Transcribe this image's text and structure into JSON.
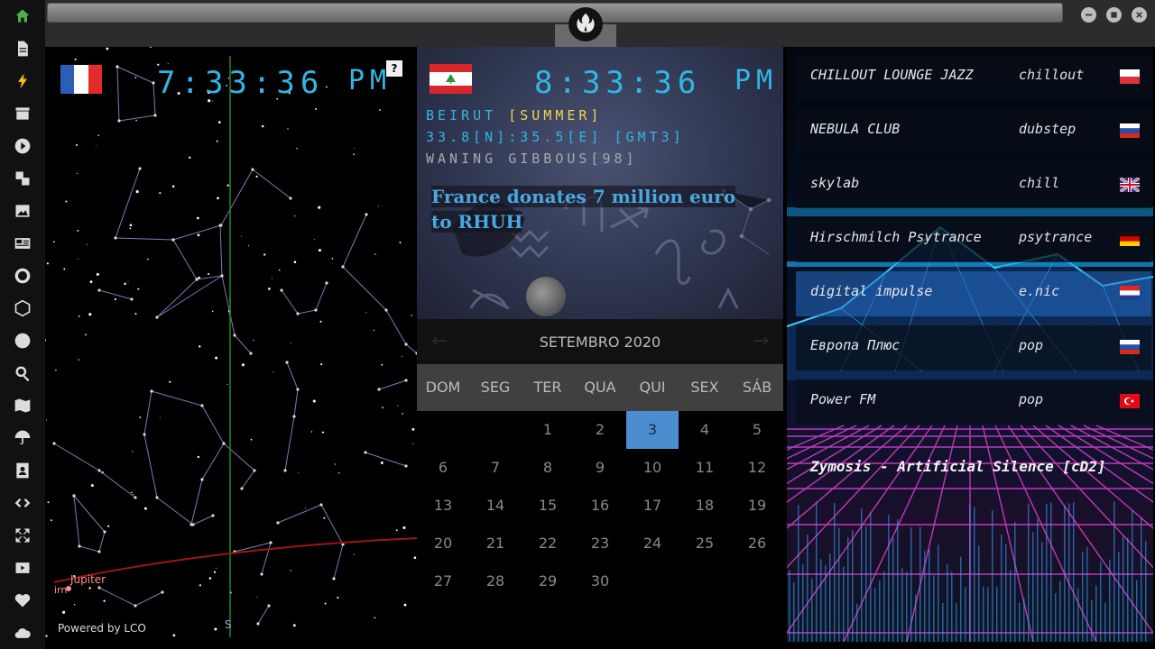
{
  "colors": {
    "accent": "#33b5e5",
    "season": "#f2d64b",
    "today": "#4a8ed0",
    "home_icon": "#4caf50"
  },
  "sidebar": {
    "items": [
      {
        "icon": "home-icon",
        "active": true
      },
      {
        "icon": "document-icon"
      },
      {
        "icon": "lightning-icon"
      },
      {
        "icon": "archive-icon"
      },
      {
        "icon": "play-icon"
      },
      {
        "icon": "translate-icon"
      },
      {
        "icon": "image-icon"
      },
      {
        "icon": "news-icon"
      },
      {
        "icon": "galactic-empire-icon"
      },
      {
        "icon": "hexagon-icon"
      },
      {
        "icon": "globe-icon"
      },
      {
        "icon": "search-icon"
      },
      {
        "icon": "map-icon"
      },
      {
        "icon": "umbrella-icon"
      },
      {
        "icon": "contact-icon"
      },
      {
        "icon": "code-icon"
      },
      {
        "icon": "expand-icon"
      },
      {
        "icon": "youtube-icon"
      },
      {
        "icon": "heart-icon"
      },
      {
        "icon": "cloud-icon"
      }
    ]
  },
  "window": {
    "logo": "rebel-alliance-icon",
    "buttons": [
      "minimize",
      "maximize",
      "close"
    ]
  },
  "sky": {
    "time": "7:33:36",
    "ampm": "PM",
    "help": "?",
    "powered": "Powered by LCO",
    "planet": "Jupiter",
    "planet_clip": "irn",
    "direction": "S"
  },
  "clock2": {
    "time": "8:33:36",
    "ampm": "PM",
    "city": "BEIRUT ",
    "season": "[SUMMER]",
    "coords": "33.8[N]:35.5[E] [GMT3]",
    "moon": "WANING GIBBOUS[98]",
    "headline": "France donates 7 million euro to RHUH"
  },
  "calendar": {
    "month": "SETEMBRO 2020",
    "prev": "←",
    "next": "→",
    "weekdays": [
      "DOM",
      "SEG",
      "TER",
      "QUA",
      "QUI",
      "SEX",
      "SÁB"
    ],
    "first_weekday": 2,
    "days_in_month": 30,
    "today": 3
  },
  "radio": {
    "stations": [
      {
        "name": "CHILLOUT LOUNGE JAZZ",
        "genre": "chillout",
        "flag": "poland"
      },
      {
        "name": "NEBULA CLUB",
        "genre": "dubstep",
        "flag": "russia"
      },
      {
        "name": "skylab",
        "genre": "chill",
        "flag": "uk"
      },
      {
        "name": "Hirschmilch Psytrance",
        "genre": "psytrance",
        "flag": "germany"
      },
      {
        "name": "digital impulse",
        "genre": "e.nic",
        "flag": "croatia",
        "active": true
      },
      {
        "name": "Европа Плюс",
        "genre": "pop",
        "flag": "russia"
      },
      {
        "name": "Power FM",
        "genre": "pop",
        "flag": "turkey"
      }
    ],
    "now_playing": "Zymosis - Artificial Silence [cD2]"
  }
}
